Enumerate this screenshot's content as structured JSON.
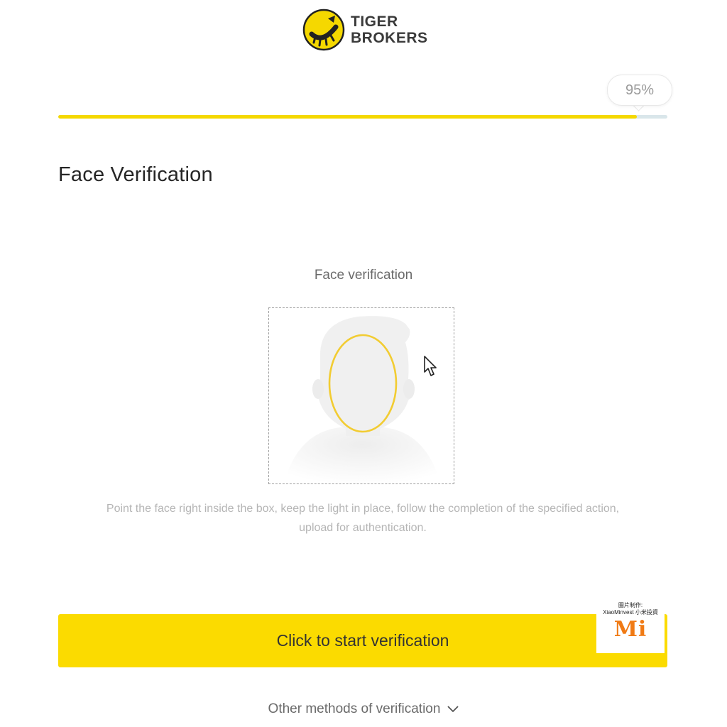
{
  "brand": {
    "name_line1": "TIGER",
    "name_line2": "BROKERS",
    "accent_color": "#f5d800"
  },
  "progress": {
    "percent_label": "95%",
    "value": 0.95
  },
  "page": {
    "title": "Face Verification"
  },
  "face_section": {
    "label": "Face verification",
    "instructions_line1": "Point the face right inside the box, keep the light in place, follow the completion of the specified action,",
    "instructions_line2": "upload for authentication."
  },
  "actions": {
    "start_label": "Click to start verification",
    "other_methods_label": "Other methods of verification"
  },
  "watermark": {
    "line1": "圖片制作:",
    "line2": "XiaoMinvest 小米投資",
    "logo_text": "Mi"
  },
  "icons": {
    "brand_logo": "tiger-claw-logo-icon",
    "face_silhouette": "face-silhouette-icon",
    "cursor": "mouse-pointer-icon",
    "chevron": "chevron-down-icon"
  }
}
